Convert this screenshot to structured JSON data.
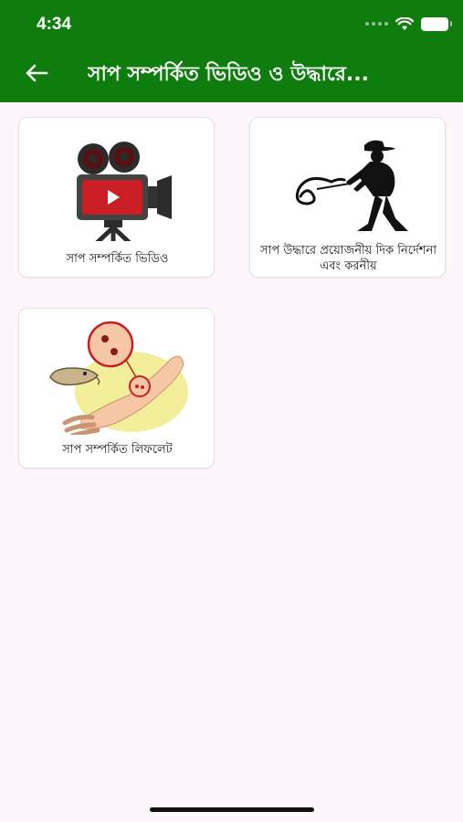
{
  "status_bar": {
    "time": "4:34",
    "icons": [
      "signal-dots-icon",
      "wifi-icon",
      "battery-icon"
    ]
  },
  "header": {
    "back_icon": "arrow-left-icon",
    "title": "সাপ সম্পর্কিত ভিডিও ও উদ্ধারে...",
    "background_color": "#0e7d0e"
  },
  "cards": [
    {
      "label": "সাপ সম্পর্কিত ভিডিও",
      "icon": "video-camera-icon"
    },
    {
      "label": "সাপ উদ্ধারে প্রয়োজনীয় দিক নির্দেশনা এবং করনীয়",
      "icon": "snake-catcher-icon"
    },
    {
      "label": "সাপ সম্পর্কিত লিফলেট",
      "icon": "snakebite-leaflet-icon"
    }
  ]
}
